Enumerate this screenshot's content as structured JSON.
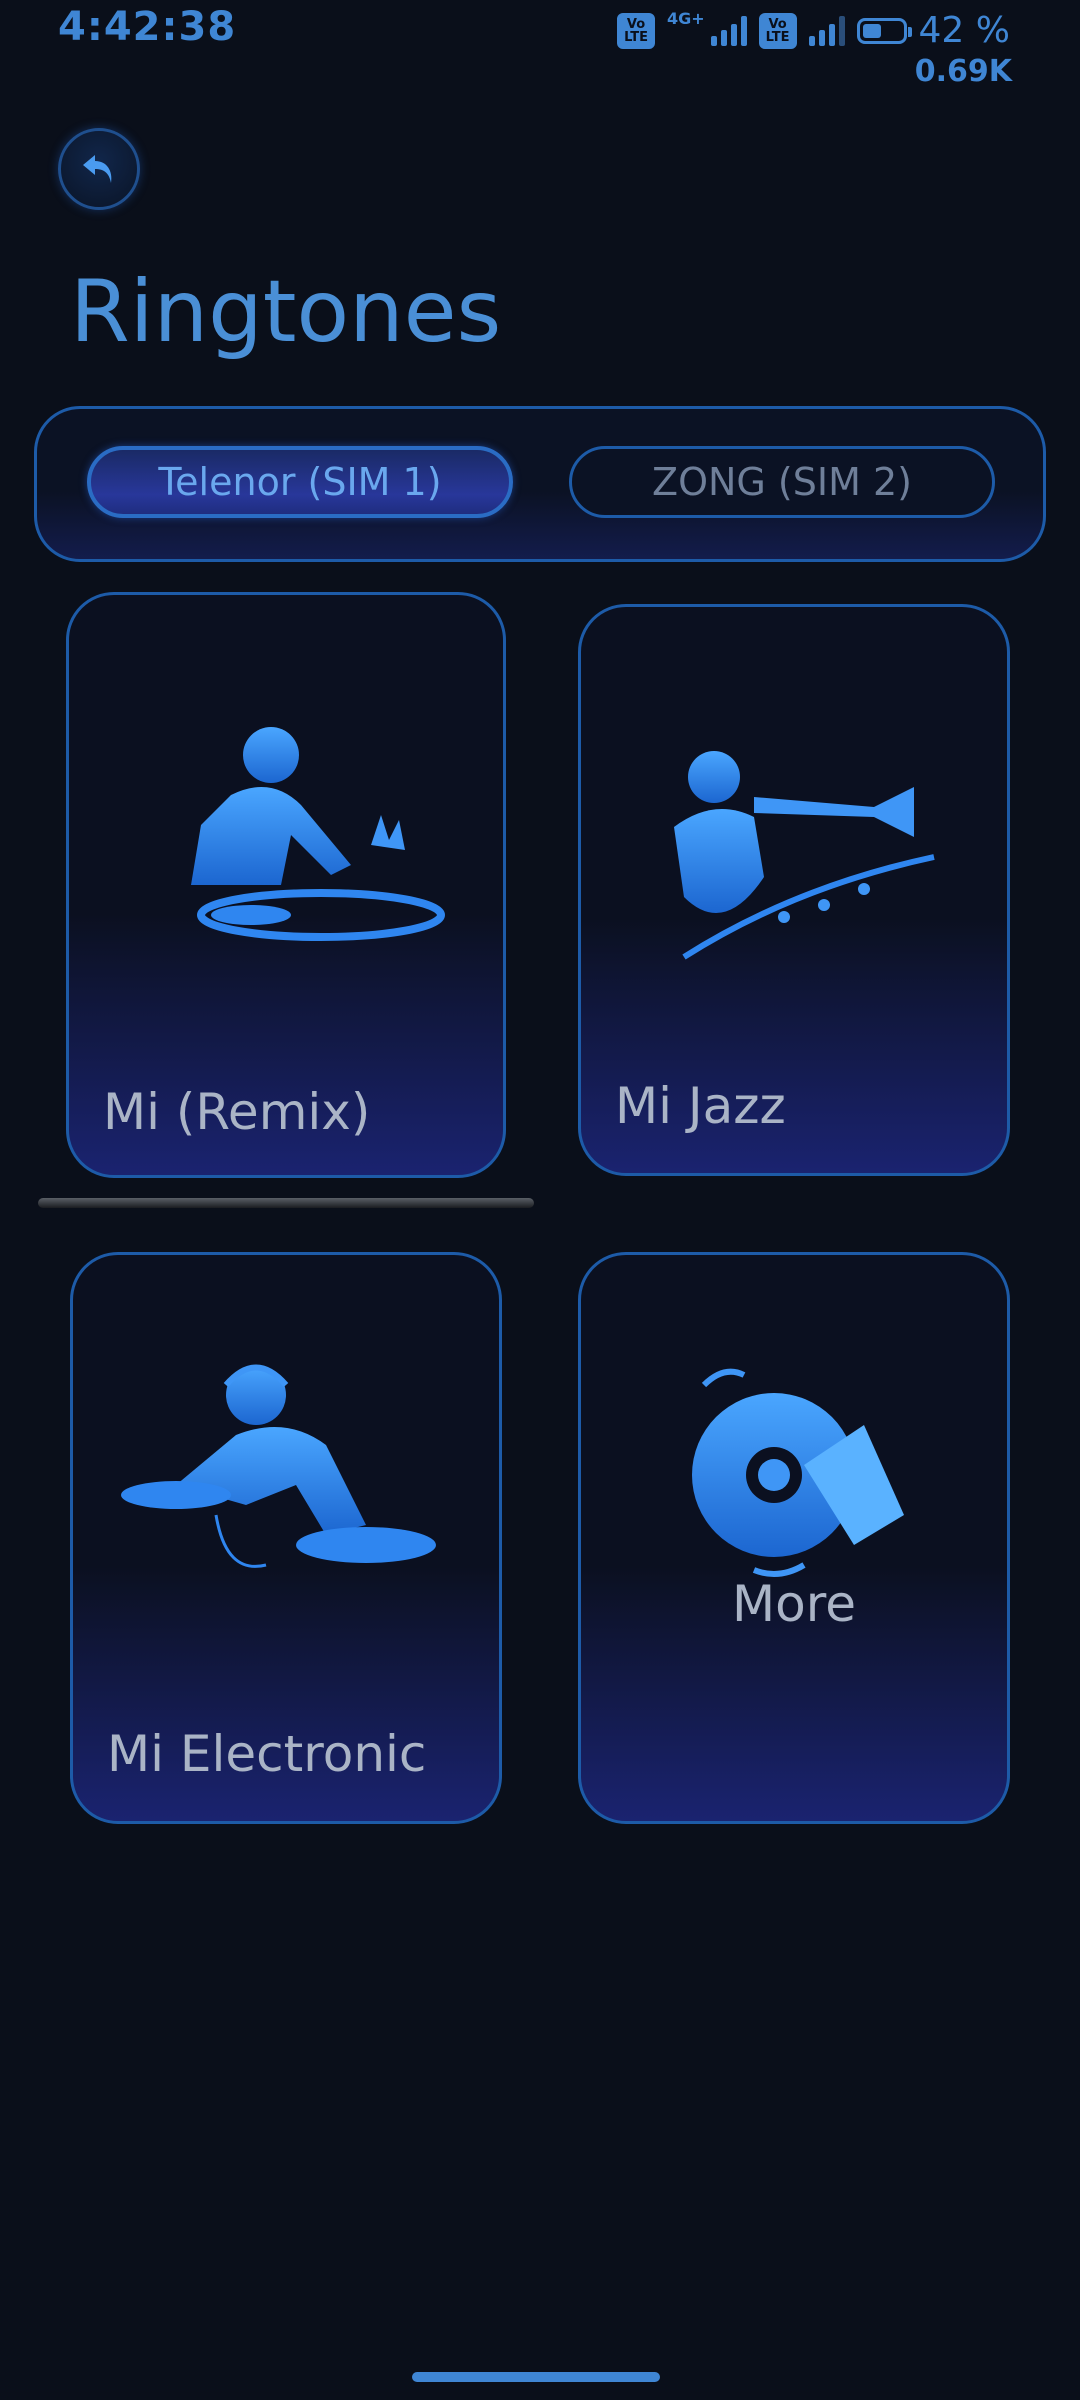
{
  "status_bar": {
    "time": "4:42:38",
    "volte1": "Vo LTE",
    "network": "4G+",
    "volte2": "Vo LTE",
    "battery": "42 %",
    "speed": "0.69K"
  },
  "header": {
    "title": "Ringtones"
  },
  "sim_tabs": [
    {
      "label": "Telenor (SIM 1)",
      "selected": true
    },
    {
      "label": "ZONG (SIM 2)",
      "selected": false
    }
  ],
  "cards": [
    {
      "label": "Mi (Remix)",
      "icon": "dj-turntable-icon"
    },
    {
      "label": "Mi Jazz",
      "icon": "trumpet-player-icon"
    },
    {
      "label": "Mi Electronic",
      "icon": "dj-headphones-icon"
    },
    {
      "label": "More",
      "icon": "disc-hand-icon"
    }
  ],
  "colors": {
    "accent": "#3f86d4",
    "background": "#0a0f1a",
    "card_border": "#1d5ba8"
  }
}
